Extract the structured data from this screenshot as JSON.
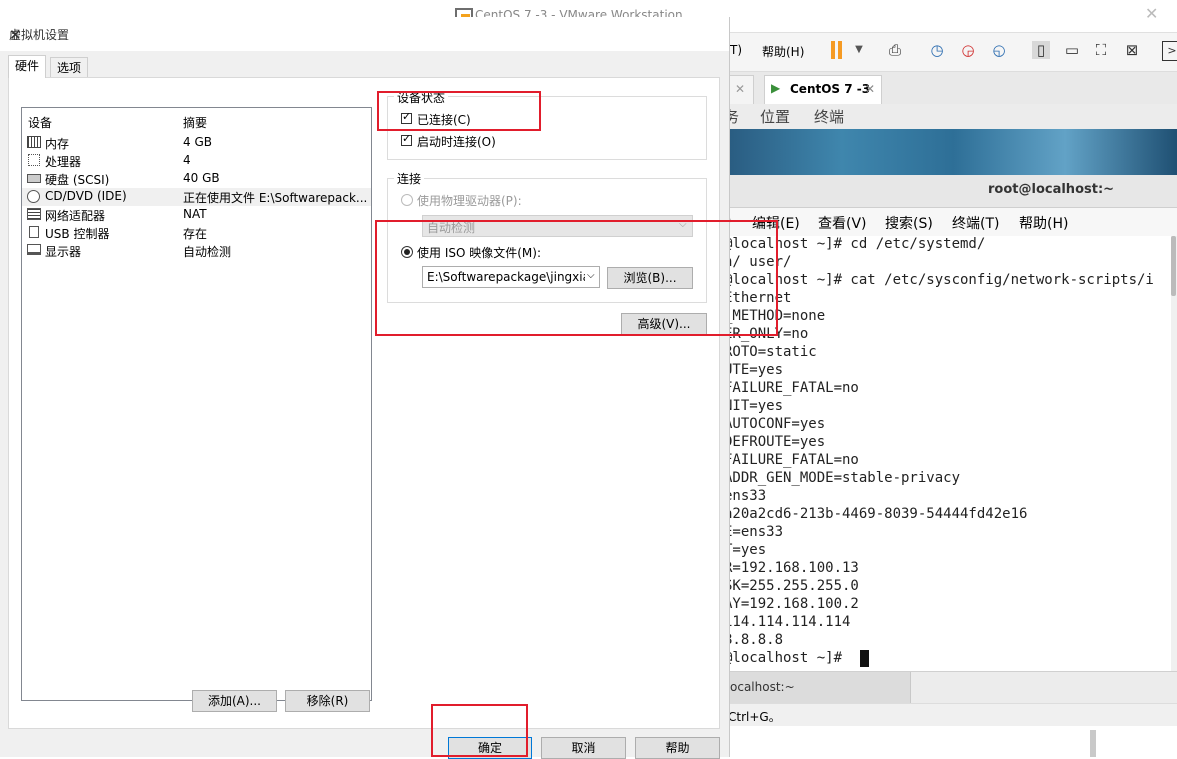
{
  "vmware": {
    "title": "CentOS 7 -3 - VMware Workstation",
    "toolbar_visible_menu": "T)",
    "toolbar_help": "帮助(H)",
    "tab_label": "CentOS 7 -3"
  },
  "gnome_bar": {
    "item1": "务",
    "item2": "位置",
    "item3": "终端"
  },
  "terminal": {
    "title": "root@localhost:~",
    "menu": [
      ")",
      "编辑(E)",
      "查看(V)",
      "搜索(S)",
      "终端(T)",
      "帮助(H)"
    ],
    "lines": [
      "@localhost ~]# cd /etc/systemd/",
      "n/ user/",
      "@localhost ~]# cat /etc/sysconfig/network-scripts/i",
      "Ethernet",
      "_METHOD=none",
      "ER_ONLY=no",
      "ROTO=static",
      "UTE=yes",
      "FAILURE_FATAL=no",
      "NIT=yes",
      "AUTOCONF=yes",
      "DEFROUTE=yes",
      "FAILURE_FATAL=no",
      "ADDR_GEN_MODE=stable-privacy",
      "ens33",
      "a20a2cd6-213b-4469-8039-54444fd42e16",
      "E=ens33",
      "T=yes",
      "R=192.168.100.13",
      "SK=255.255.255.0",
      "AY=192.168.100.2",
      "114.114.114.114",
      "8.8.8.8",
      "@localhost ~]# "
    ],
    "tab_label": "ocalhost:~"
  },
  "status_bar": "Ctrl+G。",
  "dialog": {
    "title": "虚拟机设置",
    "tabs": [
      "硬件",
      "选项"
    ],
    "columns": {
      "device": "设备",
      "summary": "摘要"
    },
    "devices": [
      {
        "name": "内存",
        "summary": "4 GB",
        "icon": "memory-icon"
      },
      {
        "name": "处理器",
        "summary": "4",
        "icon": "cpu-icon"
      },
      {
        "name": "硬盘 (SCSI)",
        "summary": "40 GB",
        "icon": "harddisk-icon"
      },
      {
        "name": "CD/DVD (IDE)",
        "summary": "正在使用文件 E:\\Softwarepack...",
        "icon": "cd-icon"
      },
      {
        "name": "网络适配器",
        "summary": "NAT",
        "icon": "network-icon"
      },
      {
        "name": "USB 控制器",
        "summary": "存在",
        "icon": "usb-icon"
      },
      {
        "name": "显示器",
        "summary": "自动检测",
        "icon": "monitor-icon"
      }
    ],
    "add_button": "添加(A)...",
    "remove_button": "移除(R)",
    "device_status": {
      "label": "设备状态",
      "connected": "已连接(C)",
      "connect_on_start": "启动时连接(O)"
    },
    "connection": {
      "label": "连接",
      "physical_drive": "使用物理驱动器(P):",
      "physical_value": "自动检测",
      "iso_file": "使用 ISO 映像文件(M):",
      "iso_value": "E:\\Softwarepackage\\jingxiar",
      "browse": "浏览(B)...",
      "advanced": "高级(V)..."
    },
    "ok": "确定",
    "cancel": "取消",
    "help": "帮助"
  },
  "colors": {
    "annotation_red": "#e11d2c",
    "vmware_orange": "#f59a23"
  }
}
